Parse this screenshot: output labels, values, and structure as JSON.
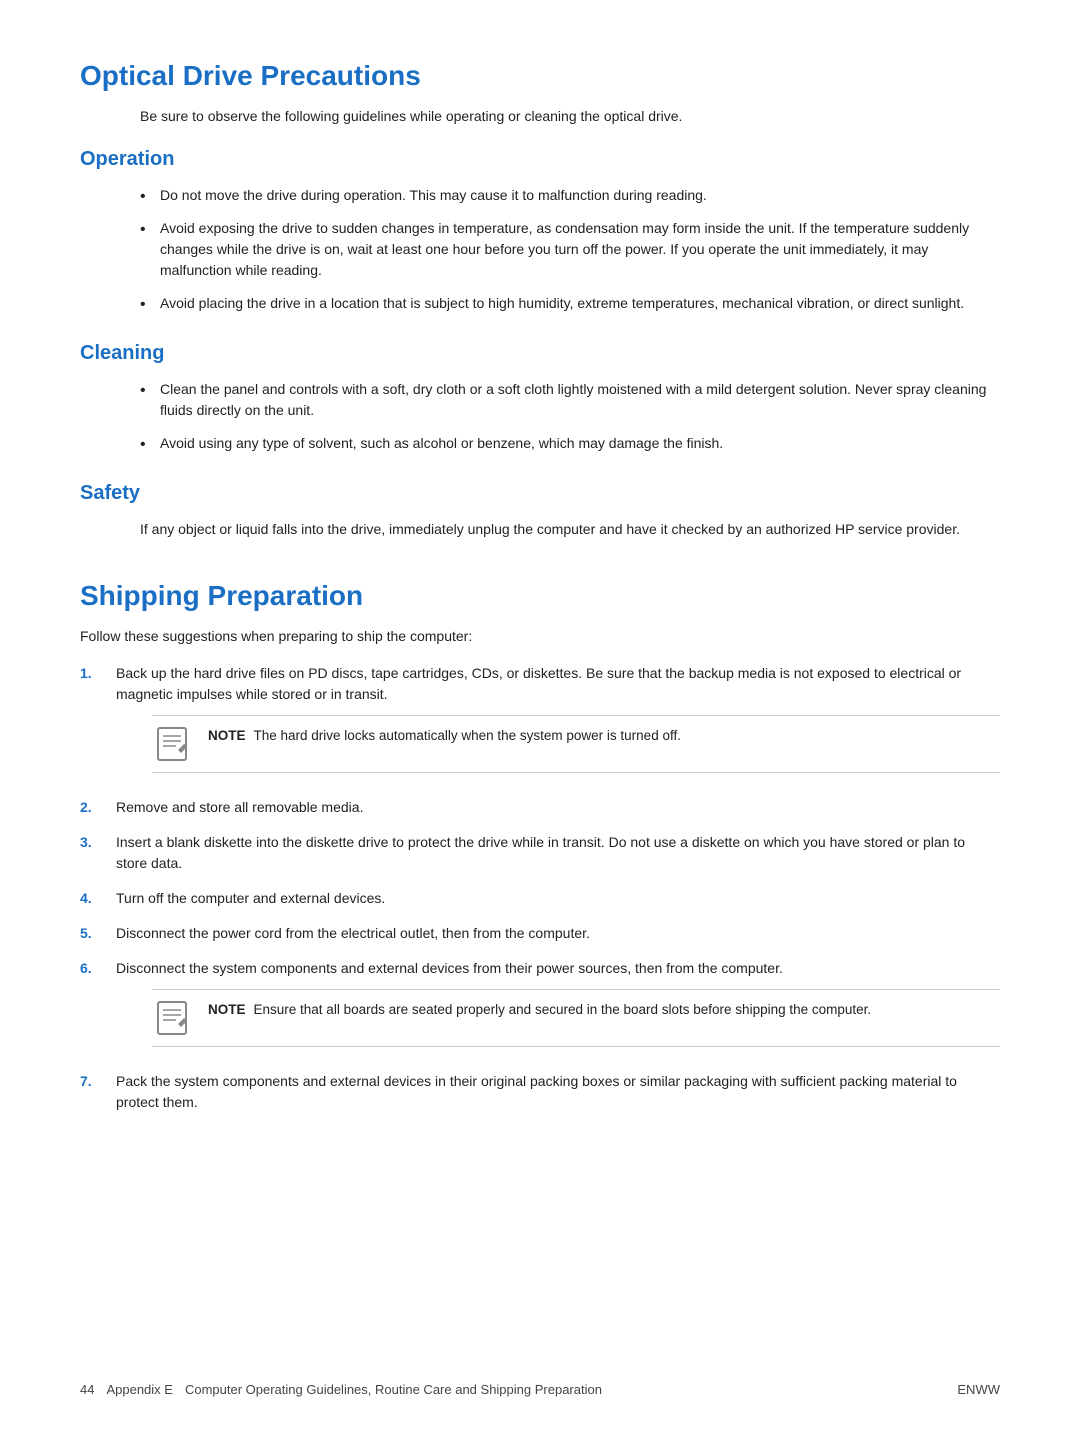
{
  "page": {
    "main_title": "Optical Drive Precautions",
    "intro": "Be sure to observe the following guidelines while operating or cleaning the optical drive.",
    "sections": {
      "operation": {
        "title": "Operation",
        "bullets": [
          "Do not move the drive during operation. This may cause it to malfunction during reading.",
          "Avoid exposing the drive to sudden changes in temperature, as condensation may form inside the unit. If the temperature suddenly changes while the drive is on, wait at least one hour before you turn off the power. If you operate the unit immediately, it may malfunction while reading.",
          "Avoid placing the drive in a location that is subject to high humidity, extreme temperatures, mechanical vibration, or direct sunlight."
        ]
      },
      "cleaning": {
        "title": "Cleaning",
        "bullets": [
          "Clean the panel and controls with a soft, dry cloth or a soft cloth lightly moistened with a mild detergent solution. Never spray cleaning fluids directly on the unit.",
          "Avoid using any type of solvent, such as alcohol or benzene, which may damage the finish."
        ]
      },
      "safety": {
        "title": "Safety",
        "text": "If any object or liquid falls into the drive, immediately unplug the computer and have it checked by an authorized HP service provider."
      }
    },
    "shipping": {
      "title": "Shipping Preparation",
      "intro": "Follow these suggestions when preparing to ship the computer:",
      "items": [
        {
          "num": "1.",
          "text": "Back up the hard drive files on PD discs, tape cartridges, CDs, or diskettes. Be sure that the backup media is not exposed to electrical or magnetic impulses while stored or in transit.",
          "note": "The hard drive locks automatically when the system power is turned off."
        },
        {
          "num": "2.",
          "text": "Remove and store all removable media.",
          "note": null
        },
        {
          "num": "3.",
          "text": "Insert a blank diskette into the diskette drive to protect the drive while in transit. Do not use a diskette on which you have stored or plan to store data.",
          "note": null
        },
        {
          "num": "4.",
          "text": "Turn off the computer and external devices.",
          "note": null
        },
        {
          "num": "5.",
          "text": "Disconnect the power cord from the electrical outlet, then from the computer.",
          "note": null
        },
        {
          "num": "6.",
          "text": "Disconnect the system components and external devices from their power sources, then from the computer.",
          "note": "Ensure that all boards are seated properly and secured in the board slots before shipping the computer."
        },
        {
          "num": "7.",
          "text": "Pack the system components and external devices in their original packing boxes or similar packaging with sufficient packing material to protect them.",
          "note": null
        }
      ]
    },
    "footer": {
      "page_num": "44",
      "appendix": "Appendix E",
      "description": "Computer Operating Guidelines, Routine Care and Shipping Preparation",
      "lang": "ENWW"
    }
  }
}
